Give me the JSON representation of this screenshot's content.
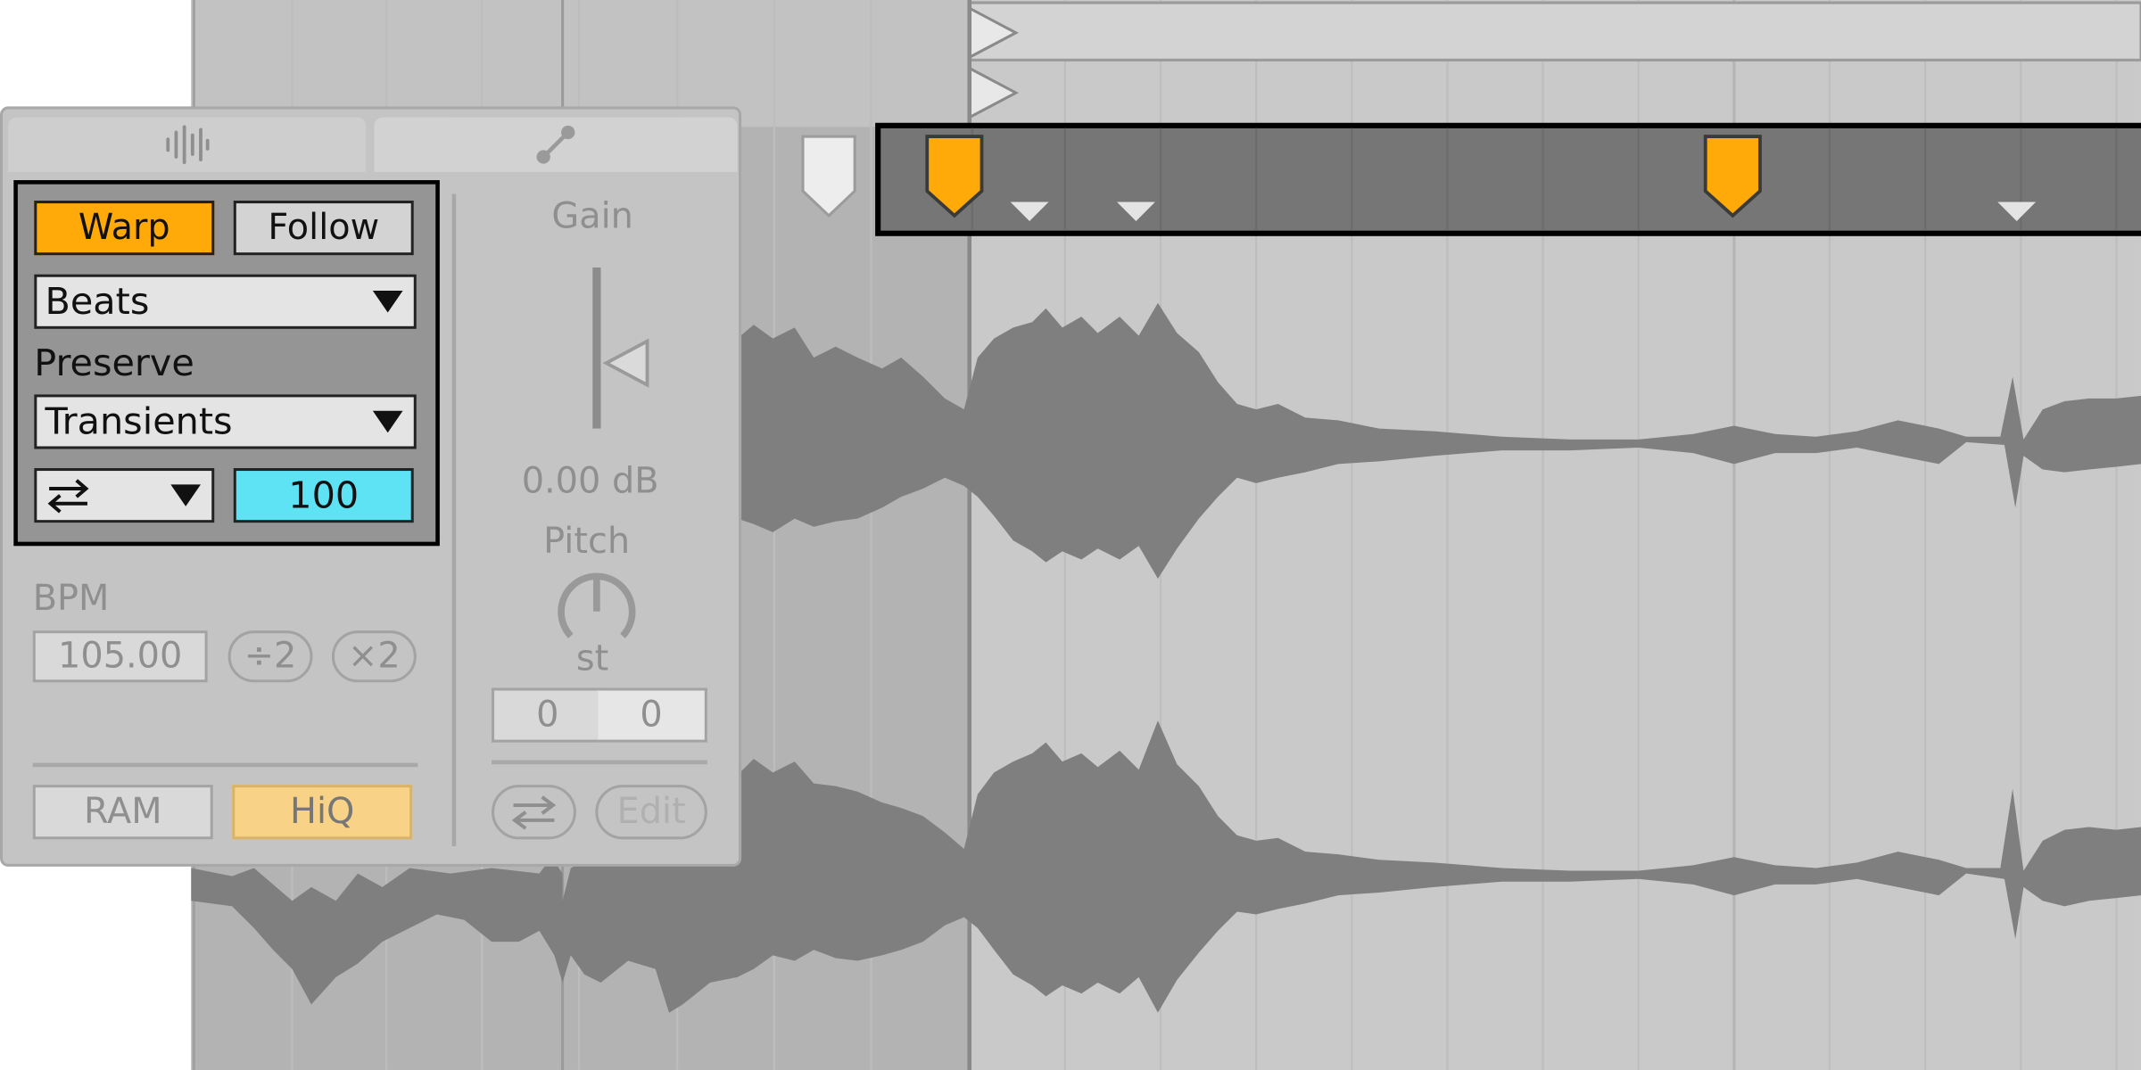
{
  "clip_view": {
    "tabs": [
      {
        "name": "sample",
        "icon": "waveform-icon"
      },
      {
        "name": "envelopes",
        "icon": "envelope-curve-icon"
      }
    ],
    "warp": {
      "warp_label": "Warp",
      "follow_label": "Follow",
      "warp_mode": "Beats",
      "preserve_label": "Preserve",
      "preserve_value": "Transients",
      "loop_mode_icon": "transient-loop-icon",
      "transient_envelope": "100",
      "active_color": "#ffaa08",
      "field_color": "#5ee3f5"
    },
    "tempo": {
      "bpm_label": "BPM",
      "bpm_value": "105.00",
      "halve_label": "÷2",
      "double_label": "×2"
    },
    "quality": {
      "ram_label": "RAM",
      "hiq_label": "HiQ",
      "hiq_color": "#f8d387"
    },
    "gain": {
      "label": "Gain",
      "value": "0.00 dB",
      "level": 0.6
    },
    "pitch": {
      "label": "Pitch",
      "knob_icon": "pitch-knob-icon",
      "unit": "st",
      "semitones": "0",
      "cents": "0"
    },
    "bottom_buttons": {
      "reverse_icon": "reverse-icon",
      "edit_label": "Edit"
    }
  },
  "sample_editor": {
    "warp_marker_color": "#ffaa08",
    "waveform_color": "#7f7f7f",
    "marker_bar_color": "#767676"
  }
}
